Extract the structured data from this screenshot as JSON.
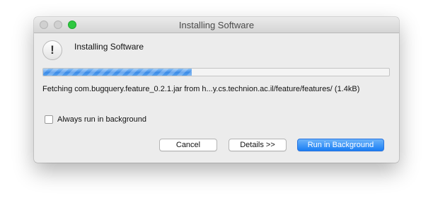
{
  "window": {
    "title": "Installing Software"
  },
  "dialog": {
    "icon": "exclamation-icon",
    "icon_glyph": "!",
    "heading": "Installing Software",
    "progress_fraction": 0.43,
    "status_text": "Fetching com.bugquery.feature_0.2.1.jar from h...y.cs.technion.ac.il/feature/features/ (1.4kB)"
  },
  "options": {
    "always_background_label": "Always run in background",
    "always_background_checked": false
  },
  "buttons": {
    "cancel": "Cancel",
    "details": "Details >>",
    "run_background": "Run in Background"
  },
  "colors": {
    "accent": "#1a7ef4",
    "progress": "#3a8ae8",
    "zoom_button": "#2fc840"
  }
}
